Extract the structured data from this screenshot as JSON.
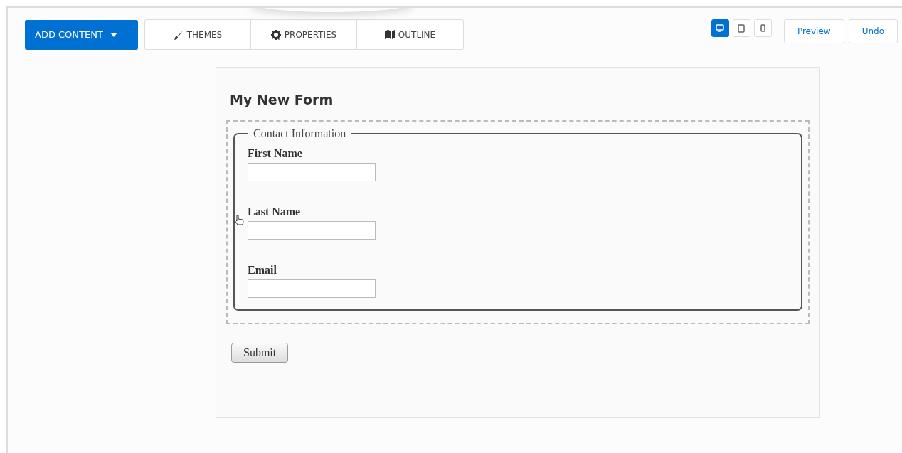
{
  "toolbar": {
    "add_button": {
      "label": "ADD CONTENT"
    },
    "tabs": [
      {
        "label": "THEMES",
        "kind": "brush"
      },
      {
        "label": "PROPERTIES",
        "kind": "gear"
      },
      {
        "label": "OUTLINE",
        "kind": "map"
      }
    ],
    "devices": [
      {
        "kind": "desktop",
        "selected": true
      },
      {
        "kind": "tablet",
        "selected": false
      },
      {
        "kind": "phone",
        "selected": false
      }
    ],
    "buttons": [
      "Preview",
      "Undo"
    ]
  },
  "form": {
    "title": "My New Form",
    "legend": "Contact Information",
    "fields": [
      {
        "label": "First Name"
      },
      {
        "label": "Last Name"
      },
      {
        "label": "Email"
      }
    ],
    "submit": "Submit"
  }
}
